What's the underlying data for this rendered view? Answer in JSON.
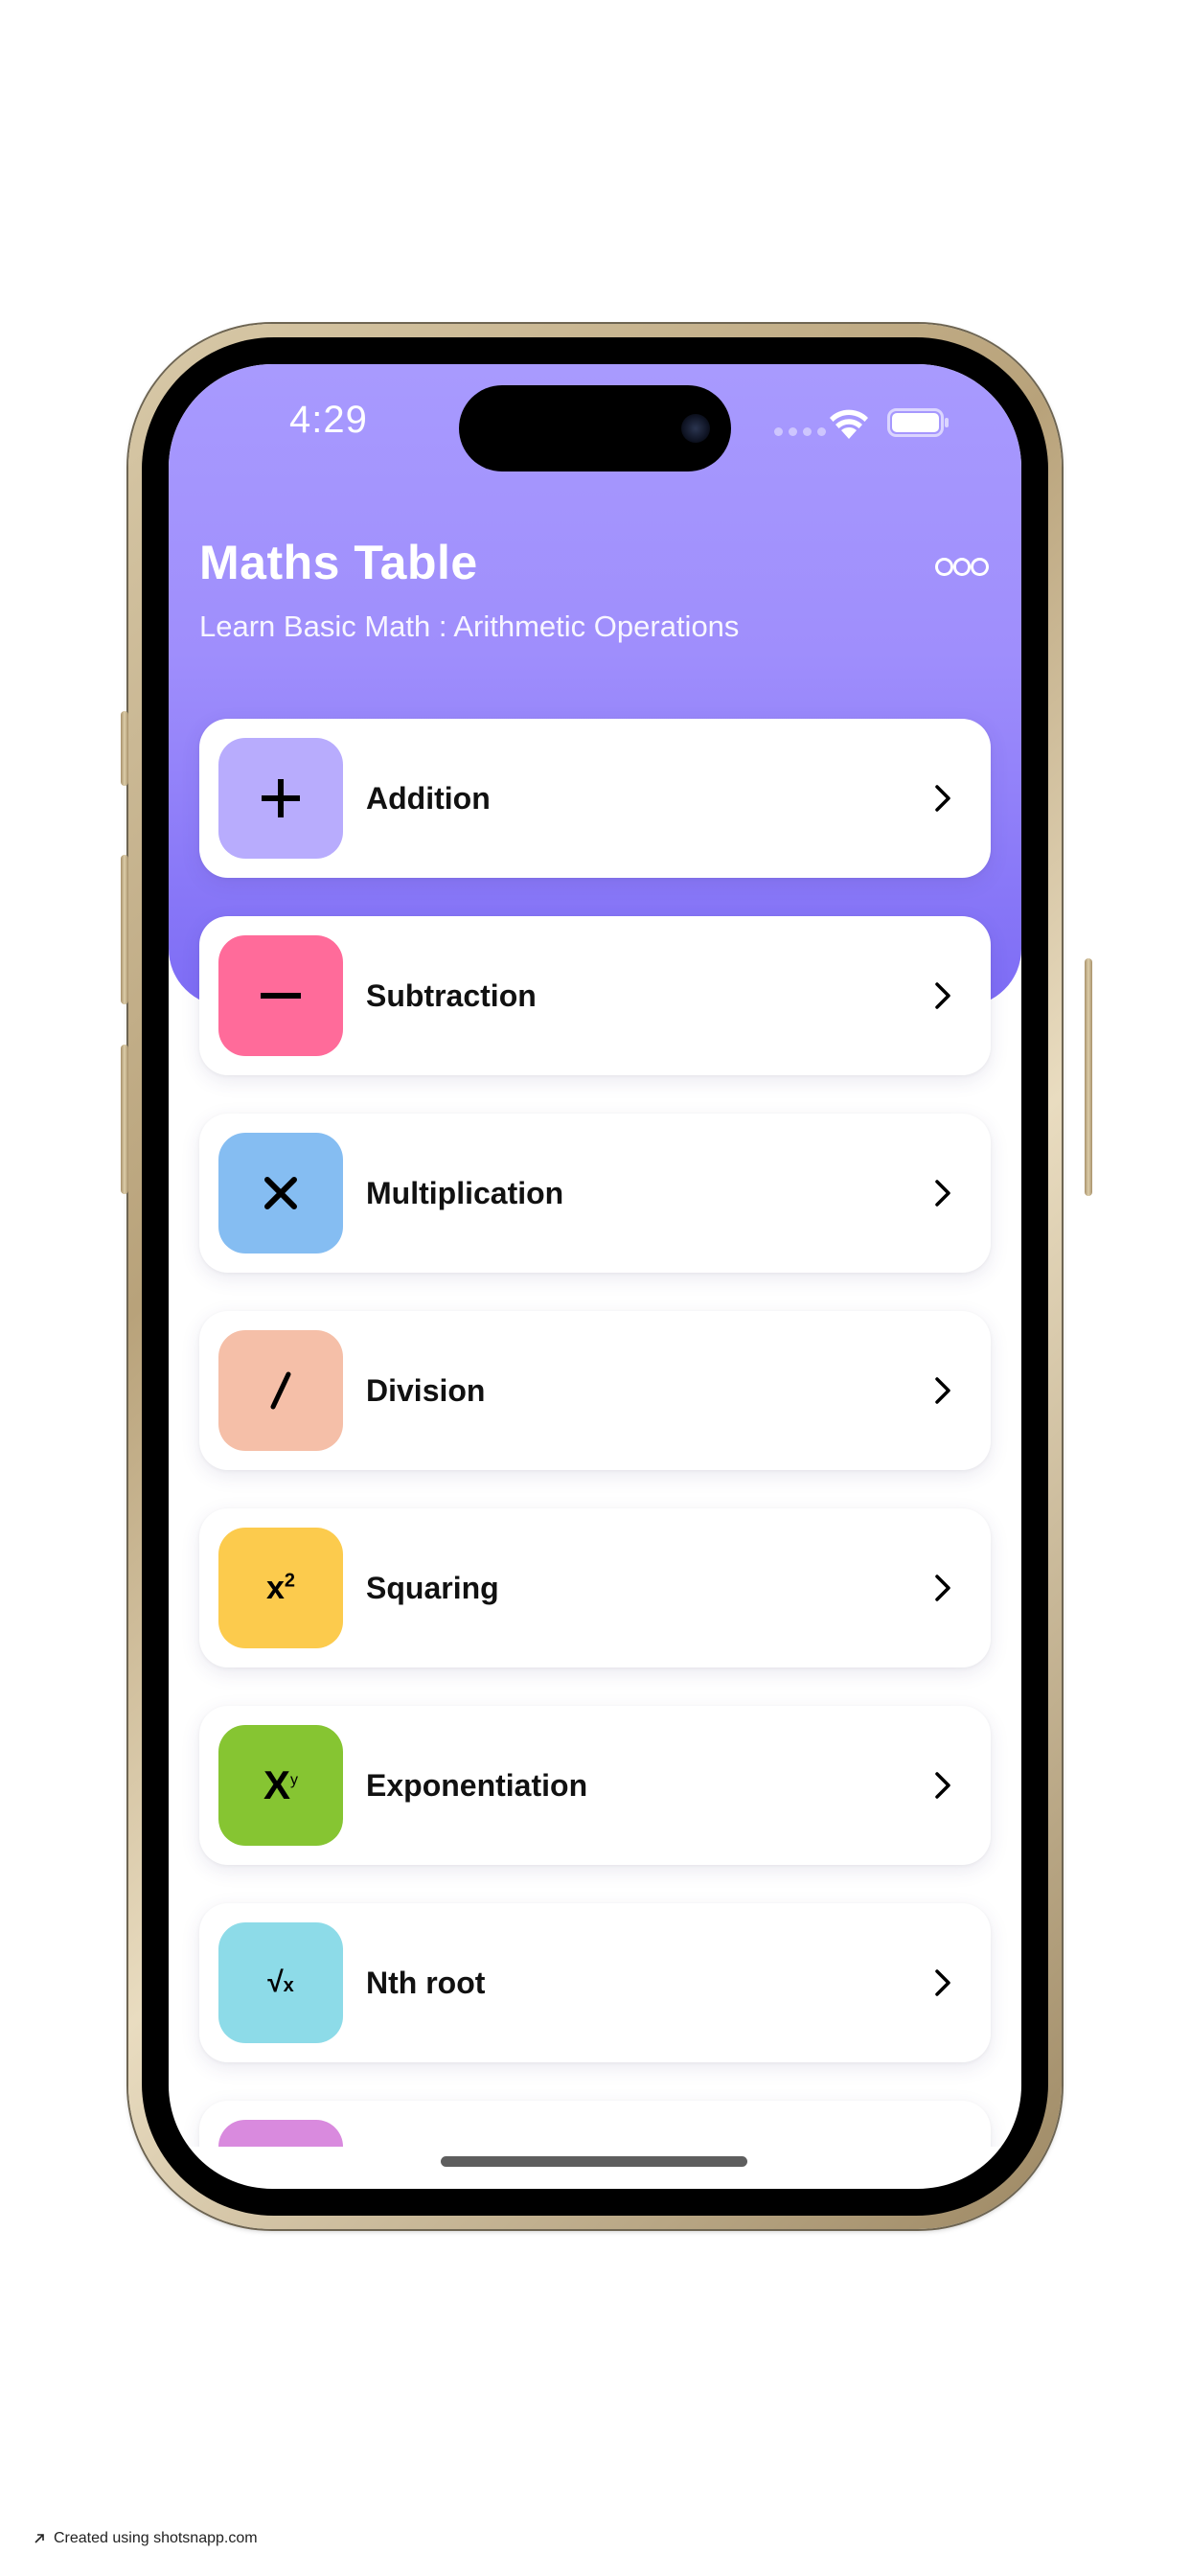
{
  "status_bar": {
    "time": "4:29"
  },
  "header": {
    "title": "Maths Table",
    "subtitle": "Learn Basic Math : Arithmetic Operations",
    "more_icon": "more-horizontal-icon"
  },
  "operations": [
    {
      "label": "Addition",
      "icon": "plus-icon",
      "symbol": "+",
      "color": "#b8acfd"
    },
    {
      "label": "Subtraction",
      "icon": "minus-icon",
      "symbol": "−",
      "color": "#ff6b9a"
    },
    {
      "label": "Multiplication",
      "icon": "times-icon",
      "symbol": "✕",
      "color": "#85bdf2"
    },
    {
      "label": "Division",
      "icon": "divide-icon",
      "symbol": "/",
      "color": "#f5bfa8"
    },
    {
      "label": "Squaring",
      "icon": "square-icon",
      "symbol": "x²",
      "color": "#fccb4d"
    },
    {
      "label": "Exponentiation",
      "icon": "exponent-icon",
      "symbol": "Xʸ",
      "color": "#86c532"
    },
    {
      "label": "Nth root",
      "icon": "root-icon",
      "symbol": "√x",
      "color": "#8ddbe8"
    },
    {
      "label": "",
      "icon": "operation-icon",
      "symbol": "",
      "color": "#d98ade"
    }
  ],
  "footer": {
    "credit": "Created using shotsnapp.com"
  }
}
